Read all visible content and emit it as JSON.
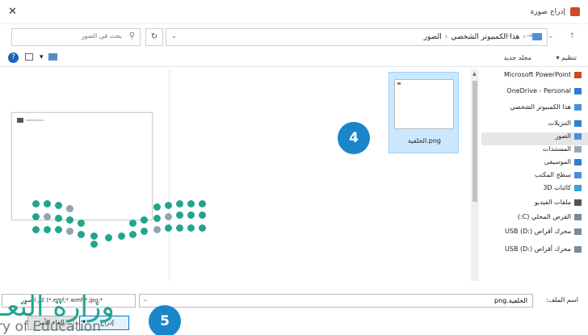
{
  "window": {
    "title": "إدراج صورة",
    "close_glyph": "✕"
  },
  "address_bar": {
    "crumbs": [
      "هذا الكمبيوتر الشخصي",
      "الصور"
    ],
    "separator": "›",
    "nav_glyphs": "← → ⌄ ↑",
    "dropdown_glyph": "⌄",
    "refresh_glyph": "↻"
  },
  "search": {
    "placeholder": "بحث في الصور",
    "icon": "search-icon"
  },
  "toolbar": {
    "organize_label": "تنظيم ▾",
    "new_folder_label": "مجلد جديد",
    "help_glyph": "?",
    "view_menu_glyph": "▾"
  },
  "nav_pane": {
    "items": [
      {
        "label": "Microsoft PowerPoint",
        "icon": "powerpoint-icon",
        "color": "#d24726"
      },
      {
        "label": "OneDrive - Personal",
        "icon": "cloud-icon",
        "color": "#2f7fd1"
      },
      {
        "label": "هذا الكمبيوتر الشخصي",
        "icon": "computer-icon",
        "color": "#4a90d9"
      },
      {
        "label": "التنزيلات",
        "icon": "download-icon",
        "color": "#2f7fd1"
      },
      {
        "label": "الصور",
        "icon": "pictures-icon",
        "color": "#4a90d9",
        "selected": true
      },
      {
        "label": "المستندات",
        "icon": "documents-icon",
        "color": "#9aa8b5"
      },
      {
        "label": "الموسيقى",
        "icon": "music-icon",
        "color": "#2f7fd1"
      },
      {
        "label": "سطح المكتب",
        "icon": "desktop-icon",
        "color": "#4a90d9"
      },
      {
        "label": "كائنات 3D",
        "icon": "objects-3d-icon",
        "color": "#3aa0e0"
      },
      {
        "label": "ملفات الفيديو",
        "icon": "video-icon",
        "color": "#555555"
      },
      {
        "label": "القرص المحلي (C:)",
        "icon": "drive-icon",
        "color": "#7a8a99"
      },
      {
        "label": "محرك أقراص USB (D:)",
        "icon": "usb-icon",
        "color": "#7a8a99"
      },
      {
        "label": "محرك أقراص USB (D:)",
        "icon": "usb-icon",
        "color": "#7a8a99"
      }
    ]
  },
  "files": [
    {
      "name": "الخلفية.png",
      "selected": true
    }
  ],
  "callouts": {
    "step4": "4",
    "step5": "5"
  },
  "bottom": {
    "filename_label": "اسم الملف:",
    "filename_value": "الخلفية.png",
    "filter_value": "كل الصور (*.emf;*.wmf;*.jpg;*",
    "insert_label": "إدراج",
    "insert_arrow": "▾",
    "cancel_label": "إلغاء الأمر",
    "dropdown_glyph": "⌄"
  },
  "watermark": {
    "arabic": "وزارة التعـ",
    "english": "ry of Education"
  },
  "colors": {
    "accent": "#1a86c9",
    "logo_green": "#22a58f",
    "logo_gray": "#93a4ad",
    "selection": "#cce8ff"
  }
}
